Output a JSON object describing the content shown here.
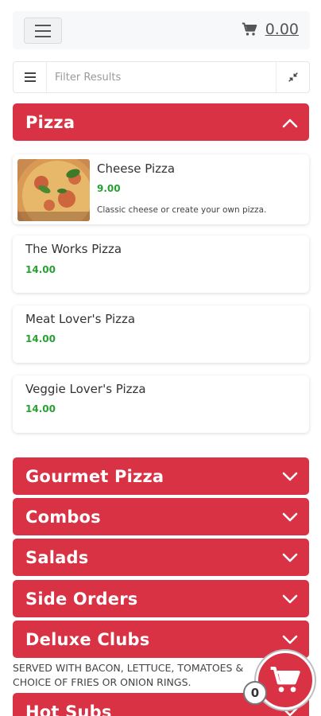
{
  "header": {
    "cart_total": "0.00",
    "menu_icon": "hamburger-icon",
    "cart_icon": "cart-icon"
  },
  "filter": {
    "placeholder": "Filter Results",
    "value": ""
  },
  "expanded_category": {
    "label": "Pizza",
    "items": [
      {
        "name": "Cheese Pizza",
        "price": "9.00",
        "description": "Classic cheese or create your own pizza."
      },
      {
        "name": "The Works Pizza",
        "price": "14.00"
      },
      {
        "name": "Meat Lover's Pizza",
        "price": "14.00"
      },
      {
        "name": "Veggie Lover's Pizza",
        "price": "14.00"
      }
    ]
  },
  "categories": [
    {
      "label": "Gourmet Pizza"
    },
    {
      "label": "Combos"
    },
    {
      "label": "Salads"
    },
    {
      "label": "Side Orders"
    },
    {
      "label": "Deluxe Clubs",
      "subtext": "SERVED WITH BACON, LETTUCE, TOMATOES & CHOICE OF FRIES OR ONION RINGS."
    },
    {
      "label": "Hot Subs"
    }
  ],
  "cart_fab": {
    "count": "0"
  },
  "colors": {
    "accent": "#d83244",
    "price": "#27a133"
  }
}
